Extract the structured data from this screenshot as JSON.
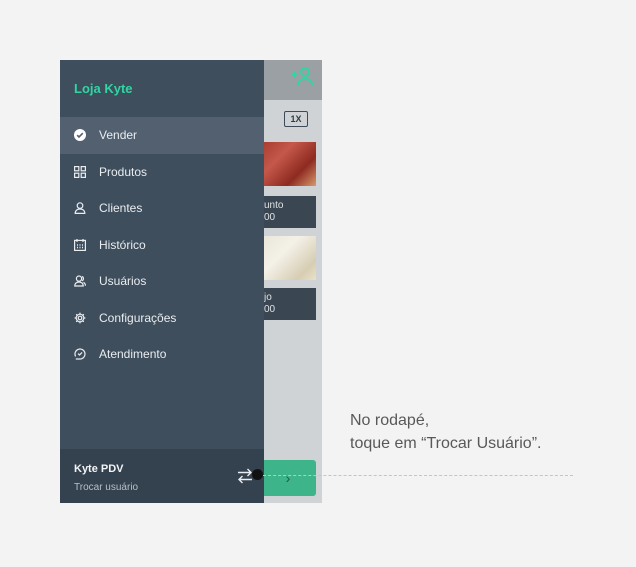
{
  "drawer": {
    "store_name": "Loja Kyte",
    "menu": [
      {
        "label": "Vender",
        "icon": "check-circle-icon",
        "active": true
      },
      {
        "label": "Produtos",
        "icon": "grid-icon",
        "active": false
      },
      {
        "label": "Clientes",
        "icon": "user-icon",
        "active": false
      },
      {
        "label": "Histórico",
        "icon": "calendar-icon",
        "active": false
      },
      {
        "label": "Usuários",
        "icon": "users-icon",
        "active": false
      },
      {
        "label": "Configurações",
        "icon": "gear-icon",
        "active": false
      },
      {
        "label": "Atendimento",
        "icon": "support-icon",
        "active": false
      }
    ],
    "footer": {
      "title": "Kyte PDV",
      "action": "Trocar usuário",
      "icon": "swap-icon"
    }
  },
  "background_app": {
    "quantity_badge": "1X",
    "products": [
      {
        "line1": "unto",
        "line2": "00"
      },
      {
        "line1": "jo",
        "line2": "00"
      }
    ],
    "continue_icon": "chevron-right-icon",
    "add_user_icon": "add-user-icon"
  },
  "callout": {
    "line1": "No rodapé,",
    "line2": "toque em “Trocar Usuário”."
  },
  "colors": {
    "accent": "#2fd6a3",
    "drawer_bg": "#3f4e5d",
    "page_bg": "#f3f3f3"
  }
}
